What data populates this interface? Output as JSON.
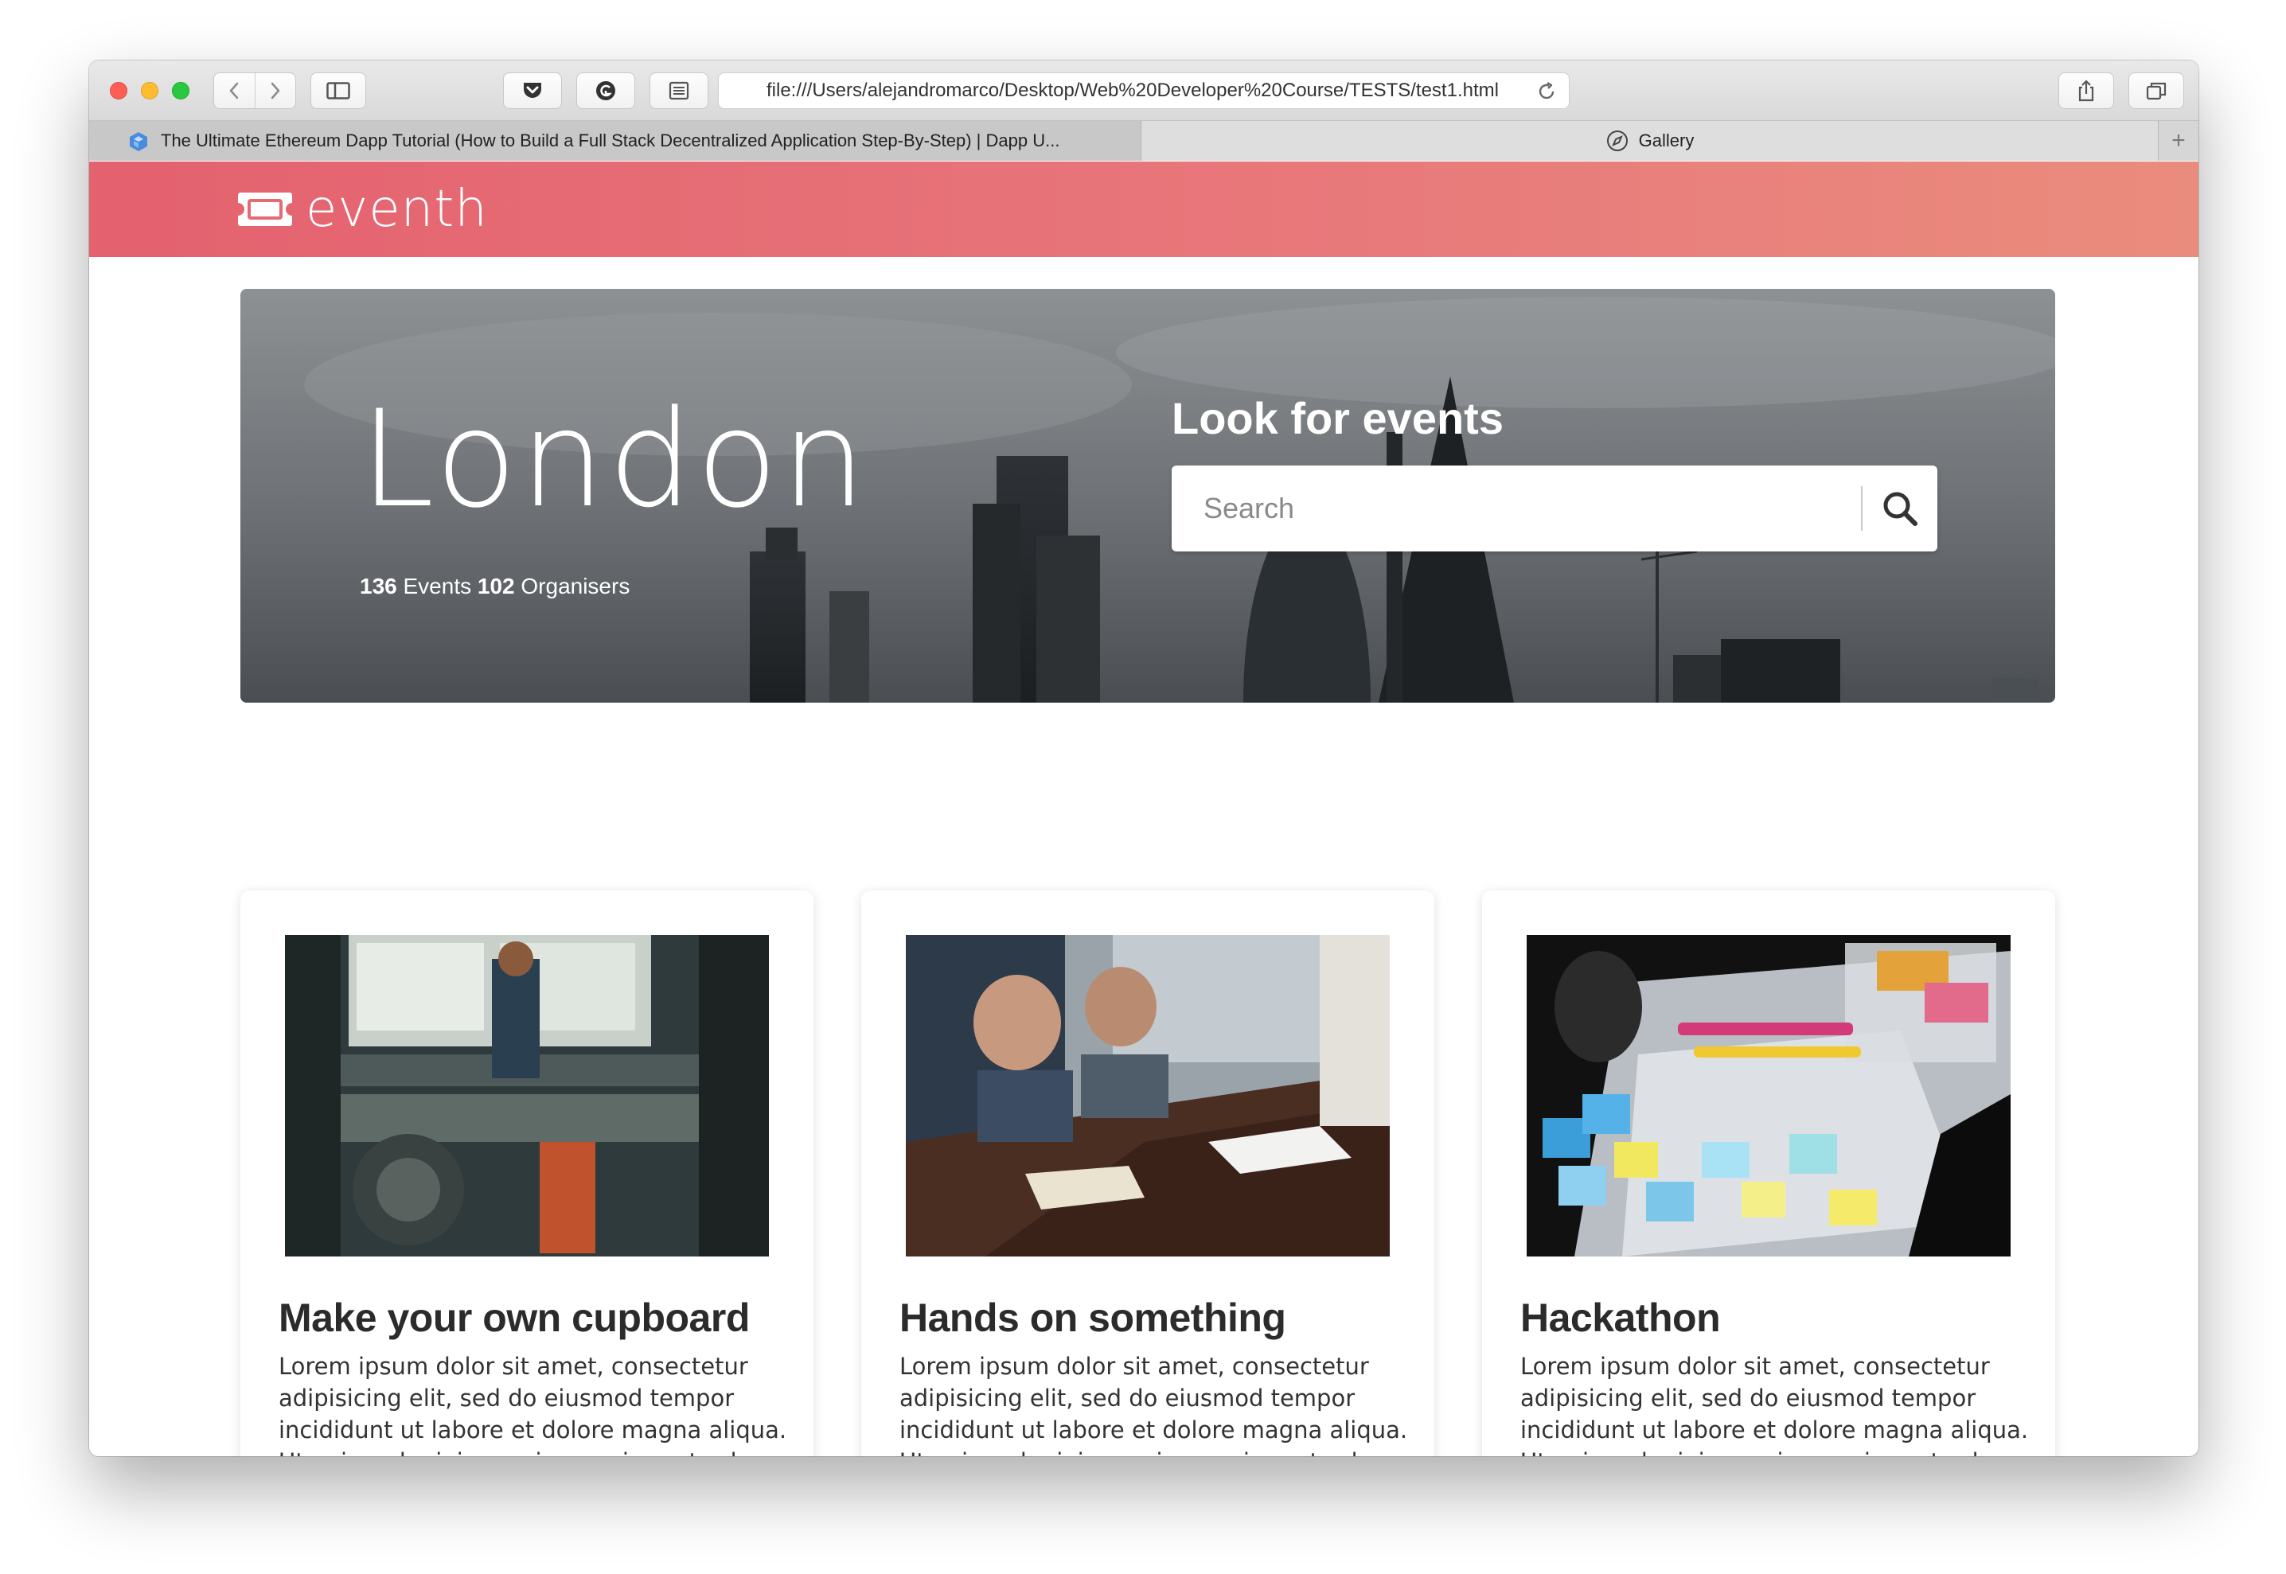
{
  "browser": {
    "url": "file:///Users/alejandromarco/Desktop/Web%20Developer%20Course/TESTS/test1.html",
    "tabs": [
      {
        "label": "The Ultimate Ethereum Dapp Tutorial (How to Build a Full Stack Decentralized Application Step-By-Step) | Dapp U..."
      },
      {
        "label": "Gallery"
      }
    ],
    "new_tab_label": "+"
  },
  "site": {
    "logo_text": "eventh",
    "brand_colors": {
      "gradient_start": "#e4616f",
      "gradient_end": "#ea8c7d"
    }
  },
  "hero": {
    "city": "London",
    "events_count": "136",
    "events_label": " Events ",
    "organisers_count": "102",
    "organisers_label": " Organisers",
    "look_title": "Look for events",
    "search_placeholder": "Search"
  },
  "cards": [
    {
      "title": "Make your own cupboard",
      "text": "Lorem ipsum dolor sit amet, consectetur adipisicing elit, sed do eiusmod tempor incididunt ut labore et dolore magna aliqua. Ut enim ad minim veniam, quis nostrud exercitation ullamco laboris nisi ut aliquip ex"
    },
    {
      "title": "Hands on something",
      "text": "Lorem ipsum dolor sit amet, consectetur adipisicing elit, sed do eiusmod tempor incididunt ut labore et dolore magna aliqua. Ut enim ad minim veniam, quis nostrud exercitation ullamco laboris nisi ut aliquip ex"
    },
    {
      "title": "Hackathon",
      "text": "Lorem ipsum dolor sit amet, consectetur adipisicing elit, sed do eiusmod tempor incididunt ut labore et dolore magna aliqua. Ut enim ad minim veniam, quis nostrud exercitation ullamco laboris nisi ut aliquip ex"
    }
  ],
  "icons": [
    "back-icon",
    "forward-icon",
    "sidebar-icon",
    "pocket-icon",
    "grammarly-icon",
    "reader-icon",
    "reload-icon",
    "share-icon",
    "tabs-overview-icon",
    "compass-icon",
    "ticket-logo-icon",
    "search-icon"
  ]
}
